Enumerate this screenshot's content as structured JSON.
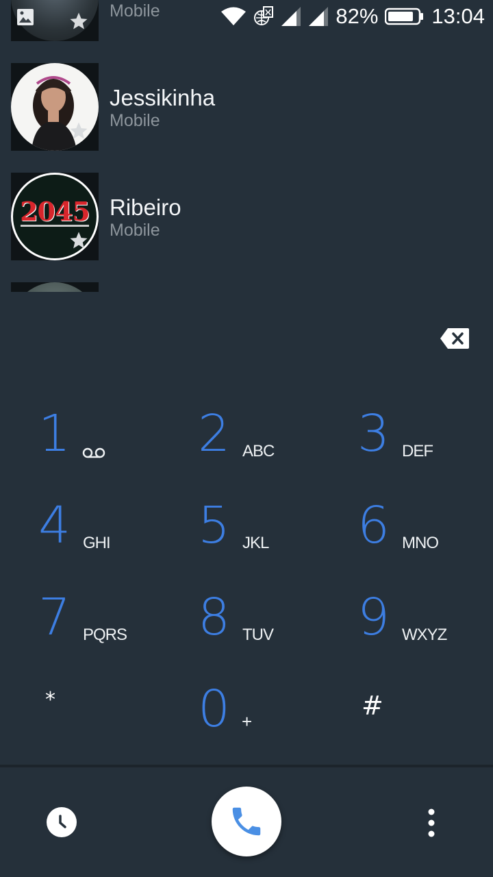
{
  "status_bar": {
    "battery_percent": "82%",
    "time": "13:04"
  },
  "contacts": [
    {
      "name": "",
      "type": "Mobile"
    },
    {
      "name": "Jessikinha",
      "type": "Mobile"
    },
    {
      "name": "Ribeiro",
      "type": "Mobile"
    }
  ],
  "avatars": {
    "ribeiro_logo_text": "2045"
  },
  "dialpad": {
    "keys": [
      {
        "digit": "1",
        "letters": ""
      },
      {
        "digit": "2",
        "letters": "ABC"
      },
      {
        "digit": "3",
        "letters": "DEF"
      },
      {
        "digit": "4",
        "letters": "GHI"
      },
      {
        "digit": "5",
        "letters": "JKL"
      },
      {
        "digit": "6",
        "letters": "MNO"
      },
      {
        "digit": "7",
        "letters": "PQRS"
      },
      {
        "digit": "8",
        "letters": "TUV"
      },
      {
        "digit": "9",
        "letters": "WXYZ"
      },
      {
        "digit": "*",
        "letters": ""
      },
      {
        "digit": "0",
        "letters": "+"
      },
      {
        "digit": "#",
        "letters": ""
      }
    ]
  },
  "colors": {
    "background": "#25303a",
    "digit_blue": "#3d7ee2",
    "call_icon_blue": "#4a8fe4"
  },
  "icons": {
    "backspace": "backspace-icon",
    "voicemail": "voicemail-icon",
    "history": "clock-icon",
    "call": "phone-icon",
    "more": "more-vert-icon",
    "favorite": "star-icon"
  }
}
